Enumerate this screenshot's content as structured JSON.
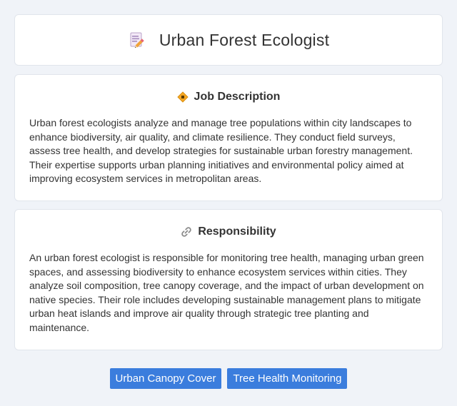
{
  "header": {
    "title": "Urban Forest Ecologist",
    "icon": "memo-pencil-icon"
  },
  "job_description": {
    "heading": "Job Description",
    "icon": "diamond-badge-icon",
    "text": "Urban forest ecologists analyze and manage tree populations within city landscapes to enhance biodiversity, air quality, and climate resilience. They conduct field surveys, assess tree health, and develop strategies for sustainable urban forestry management. Their expertise supports urban planning initiatives and environmental policy aimed at improving ecosystem services in metropolitan areas."
  },
  "responsibility": {
    "heading": "Responsibility",
    "icon": "link-icon",
    "text": "An urban forest ecologist is responsible for monitoring tree health, managing urban green spaces, and assessing biodiversity to enhance ecosystem services within cities. They analyze soil composition, tree canopy coverage, and the impact of urban development on native species. Their role includes developing sustainable management plans to mitigate urban heat islands and improve air quality through strategic tree planting and maintenance."
  },
  "tags": [
    {
      "label": "Urban Canopy Cover"
    },
    {
      "label": "Tree Health Monitoring"
    }
  ],
  "colors": {
    "background": "#f0f3f8",
    "card": "#ffffff",
    "tag": "#3b7ddd",
    "text": "#333333"
  }
}
